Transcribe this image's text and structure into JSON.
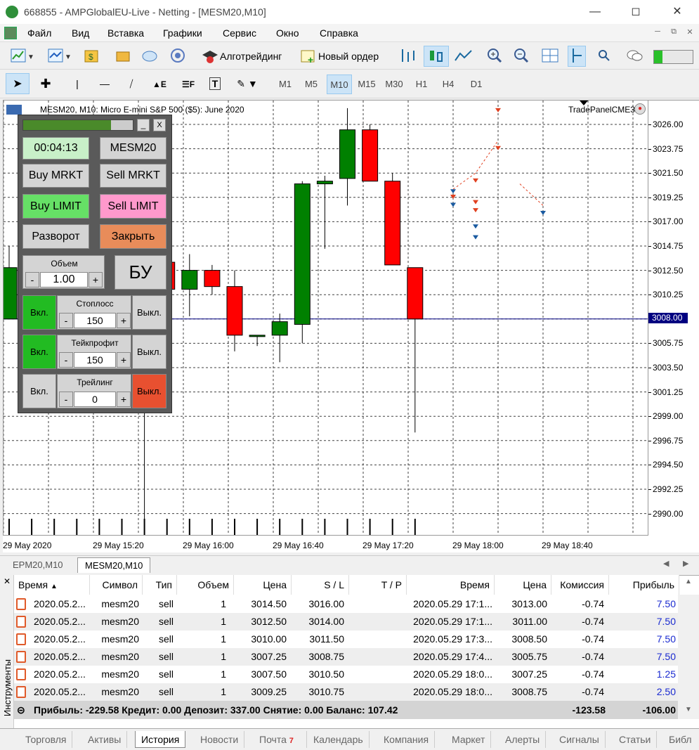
{
  "window": {
    "title": "668855 - AMPGlobalEU-Live - Netting - [MESM20,M10]"
  },
  "menu": [
    "Файл",
    "Вид",
    "Вставка",
    "Графики",
    "Сервис",
    "Окно",
    "Справка"
  ],
  "toolbar": {
    "algo_label": "Алготрейдинг",
    "new_order_label": "Новый ордер"
  },
  "timeframes": [
    "M1",
    "M5",
    "M10",
    "M15",
    "M30",
    "H1",
    "H4",
    "D1"
  ],
  "selected_timeframe": "M10",
  "chart": {
    "header": "MESM20, M10:  Micro E-mini S&P 500 ($5): June 2020",
    "ea_label": "TradePanelCME3",
    "price_labels": [
      "3026.00",
      "3023.75",
      "3021.50",
      "3019.25",
      "3017.00",
      "3014.75",
      "3012.50",
      "3010.25",
      "3008.00",
      "3005.75",
      "3003.50",
      "3001.25",
      "2999.00",
      "2996.75",
      "2994.50",
      "2992.25",
      "2990.00"
    ],
    "current_price": "3008.00",
    "time_labels": [
      "29 May 2020",
      "29 May 15:20",
      "29 May 16:00",
      "29 May 16:40",
      "29 May 17:20",
      "29 May 18:00",
      "29 May 18:40"
    ]
  },
  "chart_data": {
    "type": "candlestick",
    "symbol": "MESM20",
    "timeframe": "M10",
    "ylim": [
      2988.5,
      3027.5
    ],
    "candles": [
      {
        "o": 3008.0,
        "h": 3014.75,
        "l": 3008.0,
        "c": 3012.75
      },
      {
        "o": 3013.0,
        "h": 3014.75,
        "l": 3011.0,
        "c": 3011.0
      },
      {
        "o": 3011.0,
        "h": 3013.75,
        "l": 3005.0,
        "c": 3006.25
      },
      {
        "o": 3006.0,
        "h": 3008.75,
        "l": 3003.0,
        "c": 3007.25
      },
      {
        "o": 3007.75,
        "h": 3011.5,
        "l": 3004.25,
        "c": 3009.75
      },
      {
        "o": 3009.75,
        "h": 3010.0,
        "l": 3003.5,
        "c": 3003.5
      },
      {
        "o": 3003.5,
        "h": 3014.75,
        "l": 2989.5,
        "c": 3013.25
      },
      {
        "o": 3013.25,
        "h": 3014.75,
        "l": 3008.75,
        "c": 3010.75
      },
      {
        "o": 3010.75,
        "h": 3014.0,
        "l": 3008.25,
        "c": 3012.5
      },
      {
        "o": 3012.5,
        "h": 3013.0,
        "l": 3010.25,
        "c": 3011.0
      },
      {
        "o": 3011.0,
        "h": 3012.5,
        "l": 3005.0,
        "c": 3006.5
      },
      {
        "o": 3006.5,
        "h": 3006.5,
        "l": 3005.5,
        "c": 3006.5
      },
      {
        "o": 3006.5,
        "h": 3008.5,
        "l": 3004.0,
        "c": 3007.75
      },
      {
        "o": 3007.5,
        "h": 3020.75,
        "l": 3005.75,
        "c": 3020.5
      },
      {
        "o": 3020.5,
        "h": 3021.25,
        "l": 3014.5,
        "c": 3020.75
      },
      {
        "o": 3021.0,
        "h": 3027.5,
        "l": 3018.5,
        "c": 3025.5
      },
      {
        "o": 3025.5,
        "h": 3026.0,
        "l": 3020.75,
        "c": 3020.75
      },
      {
        "o": 3020.75,
        "h": 3021.5,
        "l": 3013.0,
        "c": 3013.0
      },
      {
        "o": 3012.75,
        "h": 3012.75,
        "l": 2997.5,
        "c": 3008.0
      }
    ]
  },
  "panel": {
    "timer": "00:04:13",
    "symbol": "MESM20",
    "buy_market": "Buy MRKT",
    "sell_market": "Sell MRKT",
    "buy_limit": "Buy LIMIT",
    "sell_limit": "Sell LIMIT",
    "reverse": "Разворот",
    "close": "Закрыть",
    "volume_label": "Объем",
    "volume_value": "1.00",
    "be": "БУ",
    "sl_label": "Стоплосс",
    "sl_value": "150",
    "tp_label": "Тейкпрофит",
    "tp_value": "150",
    "trail_label": "Трейлинг",
    "trail_value": "0",
    "on": "Вкл.",
    "off": "Выкл.",
    "minus": "-",
    "plus": "+",
    "minimize": "_",
    "close_x": "X"
  },
  "chart_tabs": [
    "EPM20,M10",
    "MESM20,M10"
  ],
  "terminal": {
    "side_label": "Инструменты",
    "columns": [
      "Время",
      "Символ",
      "Тип",
      "Объем",
      "Цена",
      "S / L",
      "T / P",
      "Время",
      "Цена",
      "Комиссия",
      "Прибыль"
    ],
    "rows": [
      [
        "2020.05.2...",
        "mesm20",
        "sell",
        "1",
        "3014.50",
        "3016.00",
        "",
        "2020.05.29 17:1...",
        "3013.00",
        "-0.74",
        "7.50"
      ],
      [
        "2020.05.2...",
        "mesm20",
        "sell",
        "1",
        "3012.50",
        "3014.00",
        "",
        "2020.05.29 17:1...",
        "3011.00",
        "-0.74",
        "7.50"
      ],
      [
        "2020.05.2...",
        "mesm20",
        "sell",
        "1",
        "3010.00",
        "3011.50",
        "",
        "2020.05.29 17:3...",
        "3008.50",
        "-0.74",
        "7.50"
      ],
      [
        "2020.05.2...",
        "mesm20",
        "sell",
        "1",
        "3007.25",
        "3008.75",
        "",
        "2020.05.29 17:4...",
        "3005.75",
        "-0.74",
        "7.50"
      ],
      [
        "2020.05.2...",
        "mesm20",
        "sell",
        "1",
        "3007.50",
        "3010.50",
        "",
        "2020.05.29 18:0...",
        "3007.25",
        "-0.74",
        "1.25"
      ],
      [
        "2020.05.2...",
        "mesm20",
        "sell",
        "1",
        "3009.25",
        "3010.75",
        "",
        "2020.05.29 18:0...",
        "3008.75",
        "-0.74",
        "2.50"
      ]
    ],
    "summary": "Прибыль: -229.58  Кредит: 0.00  Депозит: 337.00  Снятие: 0.00  Баланс: 107.42",
    "summary_commission": "-123.58",
    "summary_profit": "-106.00",
    "tabs": [
      "Торговля",
      "Активы",
      "История",
      "Новости",
      "Почта",
      "Календарь",
      "Компания",
      "Маркет",
      "Алерты",
      "Сигналы",
      "Статьи",
      "Библ"
    ],
    "mail_badge": "7",
    "selected_tab": "История"
  },
  "colors": {
    "bull": "#008000",
    "bear": "#ff0000",
    "grid": "#404040",
    "current_line": "#000080"
  }
}
